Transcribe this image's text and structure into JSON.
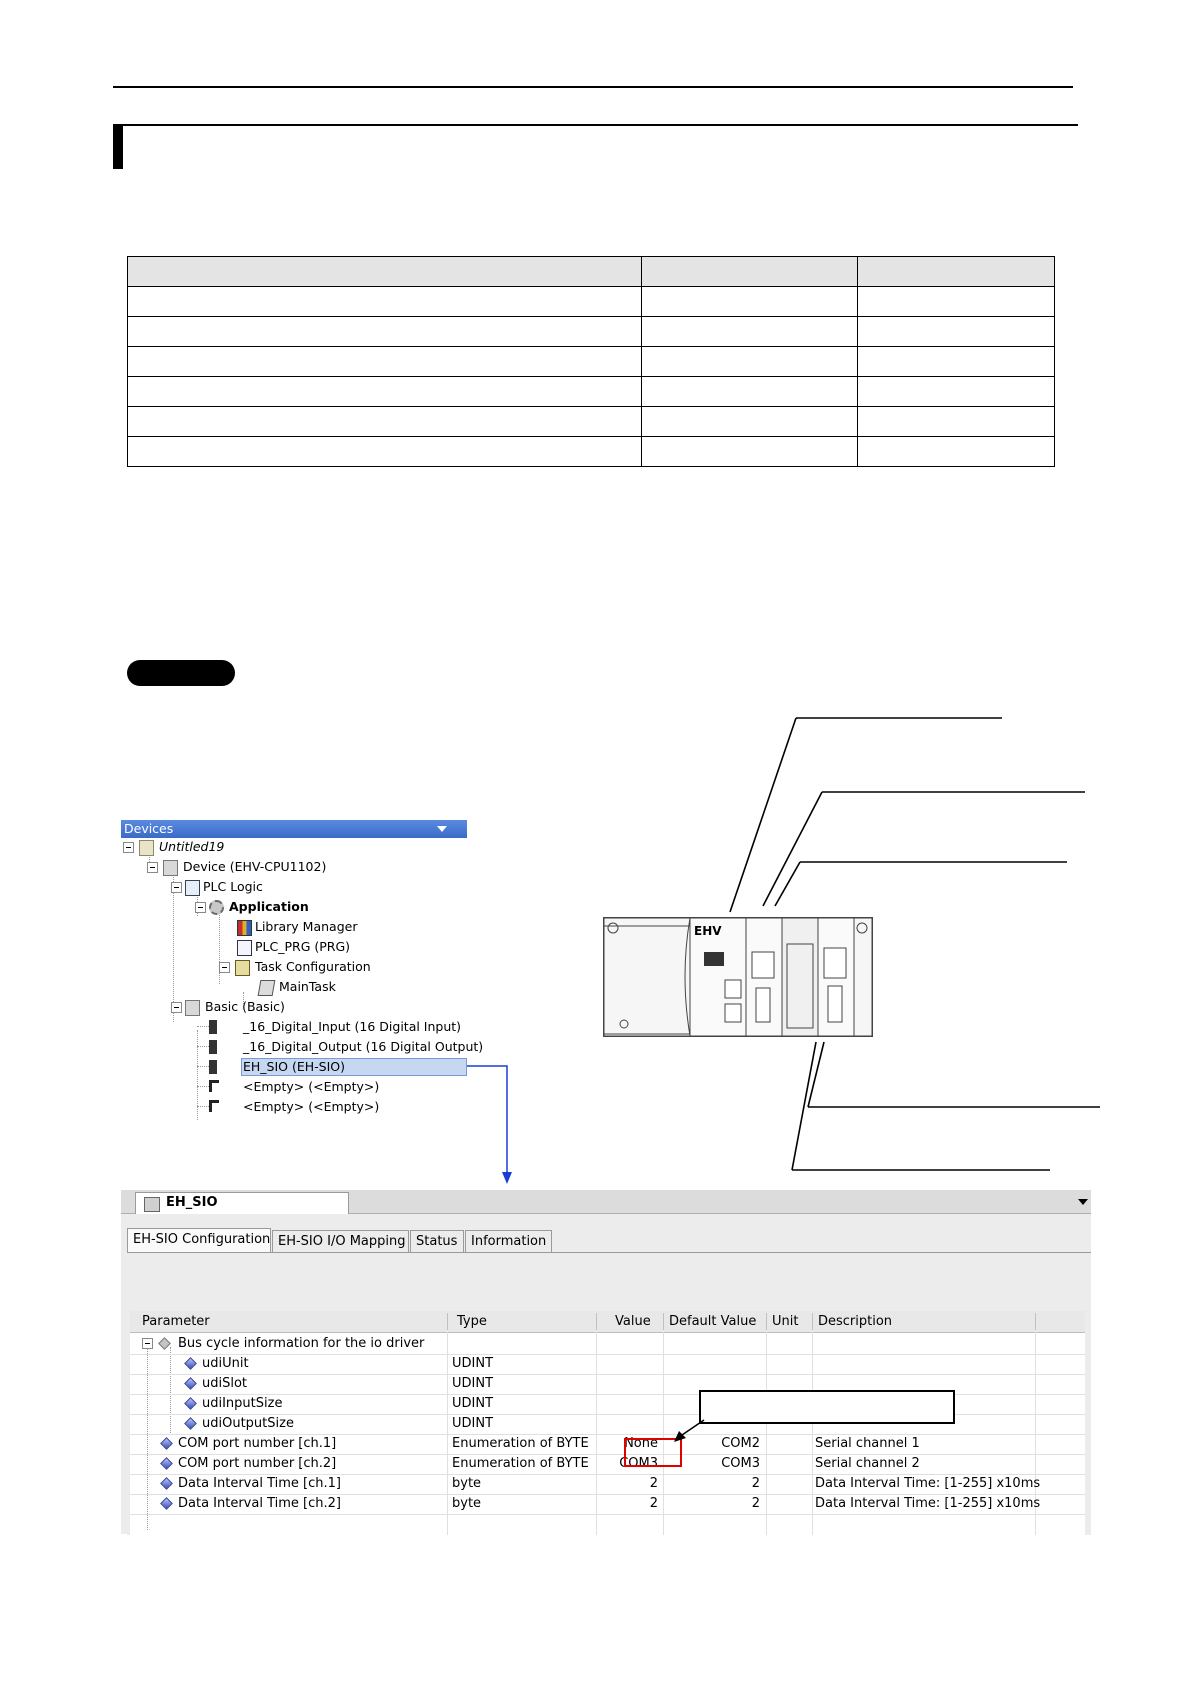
{
  "devices": {
    "header": "Devices",
    "tree": [
      {
        "label": "Untitled19",
        "icon": "project-icon"
      },
      {
        "label": "Device (EHV-CPU1102)",
        "icon": "device-icon"
      },
      {
        "label": "PLC Logic",
        "icon": "plc-logic-icon"
      },
      {
        "label": "Application",
        "icon": "application-gear-icon"
      },
      {
        "label": "Library Manager",
        "icon": "library-manager-icon"
      },
      {
        "label": "PLC_PRG (PRG)",
        "icon": "program-icon"
      },
      {
        "label": "Task Configuration",
        "icon": "task-configuration-icon"
      },
      {
        "label": "MainTask",
        "icon": "main-task-icon"
      },
      {
        "label": "Basic (Basic)",
        "icon": "basic-base-icon"
      },
      {
        "label": "_16_Digital_Input (16 Digital Input)",
        "icon": "io-module-icon"
      },
      {
        "label": "_16_Digital_Output (16 Digital Output)",
        "icon": "io-module-icon"
      },
      {
        "label": "EH_SIO (EH-SIO)",
        "icon": "io-module-icon"
      },
      {
        "label": "<Empty> (<Empty>)",
        "icon": "empty-slot-icon"
      },
      {
        "label": "<Empty> (<Empty>)",
        "icon": "empty-slot-icon"
      }
    ]
  },
  "hardware": {
    "brand_label": "EHV"
  },
  "editor": {
    "doc_tab": "EH_SIO",
    "tabs": [
      "EH-SIO Configuration",
      "EH-SIO I/O Mapping",
      "Status",
      "Information"
    ],
    "columns": [
      "Parameter",
      "Type",
      "Value",
      "Default Value",
      "Unit",
      "Description"
    ],
    "rows": [
      {
        "parameter": "Bus cycle information for the io driver",
        "type": "",
        "value": "",
        "default": "",
        "unit": "",
        "description": ""
      },
      {
        "parameter": "udiUnit",
        "type": "UDINT",
        "value": "",
        "default": "",
        "unit": "",
        "description": ""
      },
      {
        "parameter": "udiSlot",
        "type": "UDINT",
        "value": "",
        "default": "",
        "unit": "",
        "description": ""
      },
      {
        "parameter": "udiInputSize",
        "type": "UDINT",
        "value": "",
        "default": "",
        "unit": "",
        "description": ""
      },
      {
        "parameter": "udiOutputSize",
        "type": "UDINT",
        "value": "",
        "default": "",
        "unit": "",
        "description": ""
      },
      {
        "parameter": "COM port number [ch.1]",
        "type": "Enumeration of BYTE",
        "value": "None",
        "default": "COM2",
        "unit": "",
        "description": "Serial channel 1"
      },
      {
        "parameter": "COM port number [ch.2]",
        "type": "Enumeration of BYTE",
        "value": "COM3",
        "default": "COM3",
        "unit": "",
        "description": "Serial channel 2"
      },
      {
        "parameter": "Data Interval Time [ch.1]",
        "type": "byte",
        "value": "2",
        "default": "2",
        "unit": "",
        "description": "Data Interval Time: [1-255] x10ms"
      },
      {
        "parameter": "Data Interval Time [ch.2]",
        "type": "byte",
        "value": "2",
        "default": "2",
        "unit": "",
        "description": "Data Interval Time: [1-255] x10ms"
      }
    ]
  },
  "colors": {
    "highlight_box": "#e00000",
    "selection": "#c6d7f2",
    "pointer_arrow": "#1a3fd0"
  }
}
